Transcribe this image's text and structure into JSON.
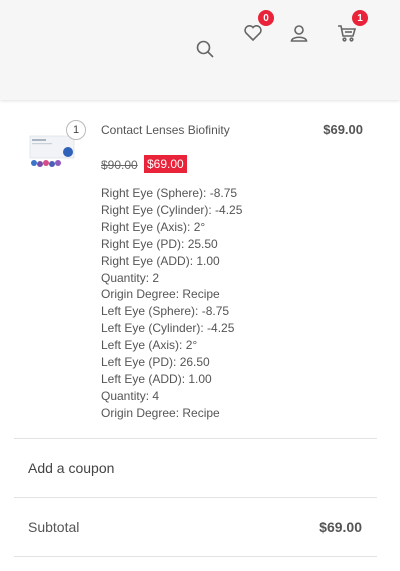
{
  "header": {
    "wishlist_count": "0",
    "cart_count": "1",
    "icons": [
      "search-icon",
      "heart-icon",
      "user-icon",
      "cart-icon"
    ]
  },
  "cart": {
    "item": {
      "quantity": "1",
      "name": "Contact Lenses Biofinity",
      "line_price": "$69.00",
      "old_price": "$90.00",
      "sale_price": "$69.00",
      "attributes": [
        "Right Eye (Sphere): -8.75",
        "Right Eye (Cylinder): -4.25",
        "Right Eye (Axis): 2°",
        "Right Eye (PD): 25.50",
        "Right Eye (ADD): 1.00",
        "Quantity: 2",
        "Origin Degree: Recipe",
        "Left Eye (Sphere): -8.75",
        "Left Eye (Cylinder): -4.25",
        "Left Eye (Axis): 2°",
        "Left Eye (PD): 26.50",
        "Left Eye (ADD): 1.00",
        "Quantity: 4",
        "Origin Degree: Recipe"
      ]
    },
    "coupon_label": "Add a coupon",
    "subtotal_label": "Subtotal",
    "subtotal_value": "$69.00"
  },
  "colors": {
    "accent": "#e8233a",
    "header_bg": "#f6f6f6"
  }
}
